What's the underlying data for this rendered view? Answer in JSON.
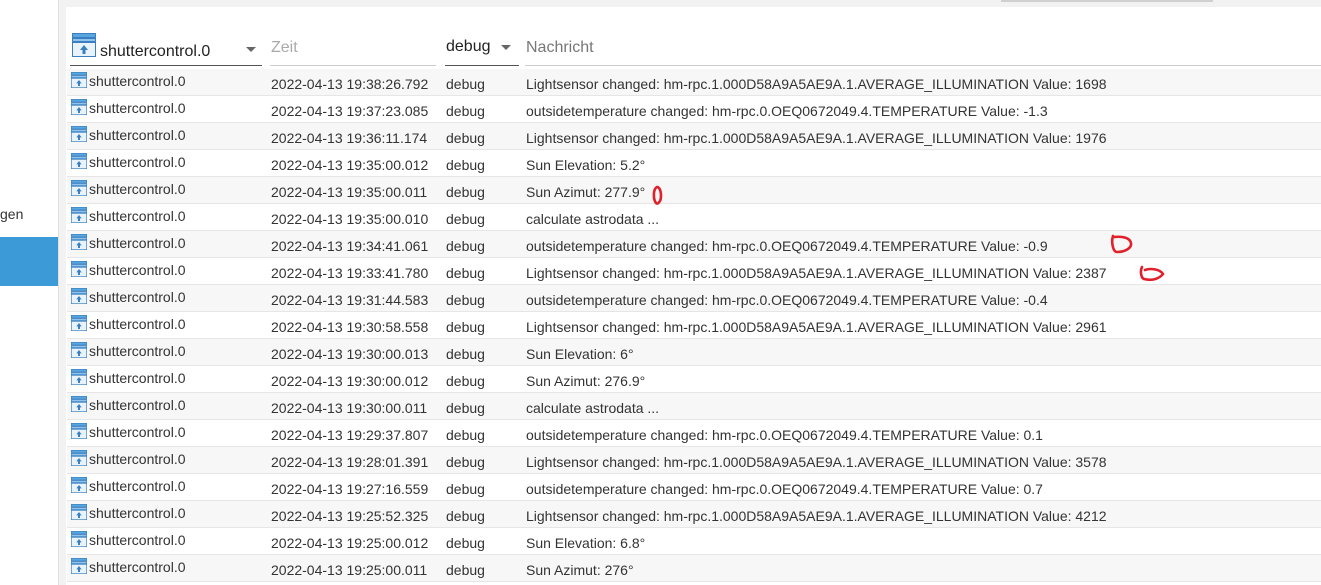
{
  "sidebar": {
    "partial_label": "gen"
  },
  "filters": {
    "source_value": "shuttercontrol.0",
    "time_placeholder": "Zeit",
    "level_value": "debug",
    "message_placeholder": "Nachricht"
  },
  "log_rows": [
    {
      "source": "shuttercontrol.0",
      "time": "2022-04-13 19:38:26.792",
      "level": "debug",
      "message": "Lightsensor changed: hm-rpc.1.000D58A9A5AE9A.1.AVERAGE_ILLUMINATION Value: 1698"
    },
    {
      "source": "shuttercontrol.0",
      "time": "2022-04-13 19:37:23.085",
      "level": "debug",
      "message": "outsidetemperature changed: hm-rpc.0.OEQ0672049.4.TEMPERATURE Value: -1.3"
    },
    {
      "source": "shuttercontrol.0",
      "time": "2022-04-13 19:36:11.174",
      "level": "debug",
      "message": "Lightsensor changed: hm-rpc.1.000D58A9A5AE9A.1.AVERAGE_ILLUMINATION Value: 1976"
    },
    {
      "source": "shuttercontrol.0",
      "time": "2022-04-13 19:35:00.012",
      "level": "debug",
      "message": "Sun Elevation: 5.2°"
    },
    {
      "source": "shuttercontrol.0",
      "time": "2022-04-13 19:35:00.011",
      "level": "debug",
      "message": "Sun Azimut: 277.9°"
    },
    {
      "source": "shuttercontrol.0",
      "time": "2022-04-13 19:35:00.010",
      "level": "debug",
      "message": "calculate astrodata ..."
    },
    {
      "source": "shuttercontrol.0",
      "time": "2022-04-13 19:34:41.061",
      "level": "debug",
      "message": "outsidetemperature changed: hm-rpc.0.OEQ0672049.4.TEMPERATURE Value: -0.9"
    },
    {
      "source": "shuttercontrol.0",
      "time": "2022-04-13 19:33:41.780",
      "level": "debug",
      "message": "Lightsensor changed: hm-rpc.1.000D58A9A5AE9A.1.AVERAGE_ILLUMINATION Value: 2387"
    },
    {
      "source": "shuttercontrol.0",
      "time": "2022-04-13 19:31:44.583",
      "level": "debug",
      "message": "outsidetemperature changed: hm-rpc.0.OEQ0672049.4.TEMPERATURE Value: -0.4"
    },
    {
      "source": "shuttercontrol.0",
      "time": "2022-04-13 19:30:58.558",
      "level": "debug",
      "message": "Lightsensor changed: hm-rpc.1.000D58A9A5AE9A.1.AVERAGE_ILLUMINATION Value: 2961"
    },
    {
      "source": "shuttercontrol.0",
      "time": "2022-04-13 19:30:00.013",
      "level": "debug",
      "message": "Sun Elevation: 6°"
    },
    {
      "source": "shuttercontrol.0",
      "time": "2022-04-13 19:30:00.012",
      "level": "debug",
      "message": "Sun Azimut: 276.9°"
    },
    {
      "source": "shuttercontrol.0",
      "time": "2022-04-13 19:30:00.011",
      "level": "debug",
      "message": "calculate astrodata ..."
    },
    {
      "source": "shuttercontrol.0",
      "time": "2022-04-13 19:29:37.807",
      "level": "debug",
      "message": "outsidetemperature changed: hm-rpc.0.OEQ0672049.4.TEMPERATURE Value: 0.1"
    },
    {
      "source": "shuttercontrol.0",
      "time": "2022-04-13 19:28:01.391",
      "level": "debug",
      "message": "Lightsensor changed: hm-rpc.1.000D58A9A5AE9A.1.AVERAGE_ILLUMINATION Value: 3578"
    },
    {
      "source": "shuttercontrol.0",
      "time": "2022-04-13 19:27:16.559",
      "level": "debug",
      "message": "outsidetemperature changed: hm-rpc.0.OEQ0672049.4.TEMPERATURE Value: 0.7"
    },
    {
      "source": "shuttercontrol.0",
      "time": "2022-04-13 19:25:52.325",
      "level": "debug",
      "message": "Lightsensor changed: hm-rpc.1.000D58A9A5AE9A.1.AVERAGE_ILLUMINATION Value: 4212"
    },
    {
      "source": "shuttercontrol.0",
      "time": "2022-04-13 19:25:00.012",
      "level": "debug",
      "message": "Sun Elevation: 6.8°"
    },
    {
      "source": "shuttercontrol.0",
      "time": "2022-04-13 19:25:00.011",
      "level": "debug",
      "message": "Sun Azimut: 276°"
    }
  ],
  "icons": {
    "source": "shuttercontrol-adapter-icon",
    "caret": "chevron-down-icon"
  },
  "colors": {
    "sidebar_active": "#3c9ad6",
    "annotation": "#e0202a"
  }
}
